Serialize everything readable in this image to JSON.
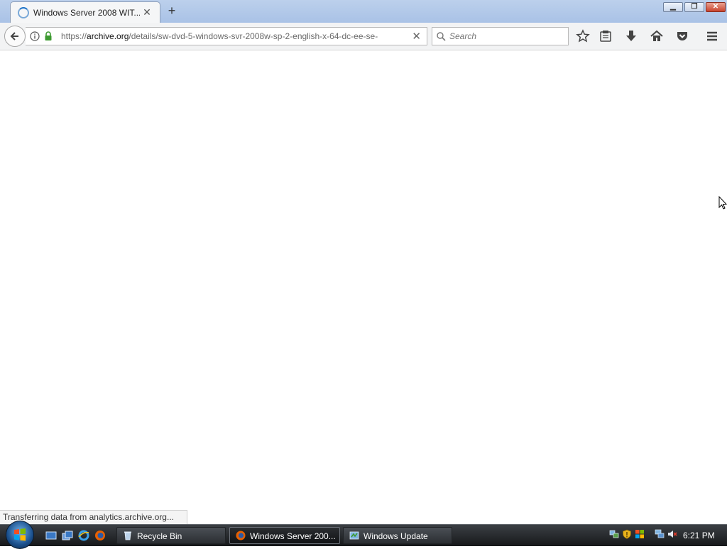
{
  "browser": {
    "tab": {
      "title": "Windows Server 2008 WIT...",
      "close_icon": "close-icon"
    },
    "new_tab_icon": "plus-icon",
    "window_controls": {
      "minimize_icon": "minimize-icon",
      "maximize_icon": "restore-icon",
      "close_icon": "close-icon"
    },
    "navigation": {
      "url_prefix": "https://",
      "url_domain": "archive.org",
      "url_path": "/details/sw-dvd-5-windows-svr-2008w-sp-2-english-x-64-dc-ee-se-",
      "search_placeholder": "Search"
    },
    "status_text": "Transferring data from analytics.archive.org..."
  },
  "taskbar": {
    "quick_launch": [
      "show-desktop-icon",
      "switch-windows-icon",
      "internet-explorer-icon",
      "firefox-icon"
    ],
    "tasks": [
      {
        "label": "Recycle Bin",
        "active": false
      },
      {
        "label": "Windows Server 200...",
        "active": true
      },
      {
        "label": "Windows Update",
        "active": false
      }
    ],
    "clock": "6:21 PM"
  },
  "colors": {
    "accent": "#1e73c8",
    "secure_lock": "#3d9a30",
    "taskbar": "#1f2225"
  }
}
